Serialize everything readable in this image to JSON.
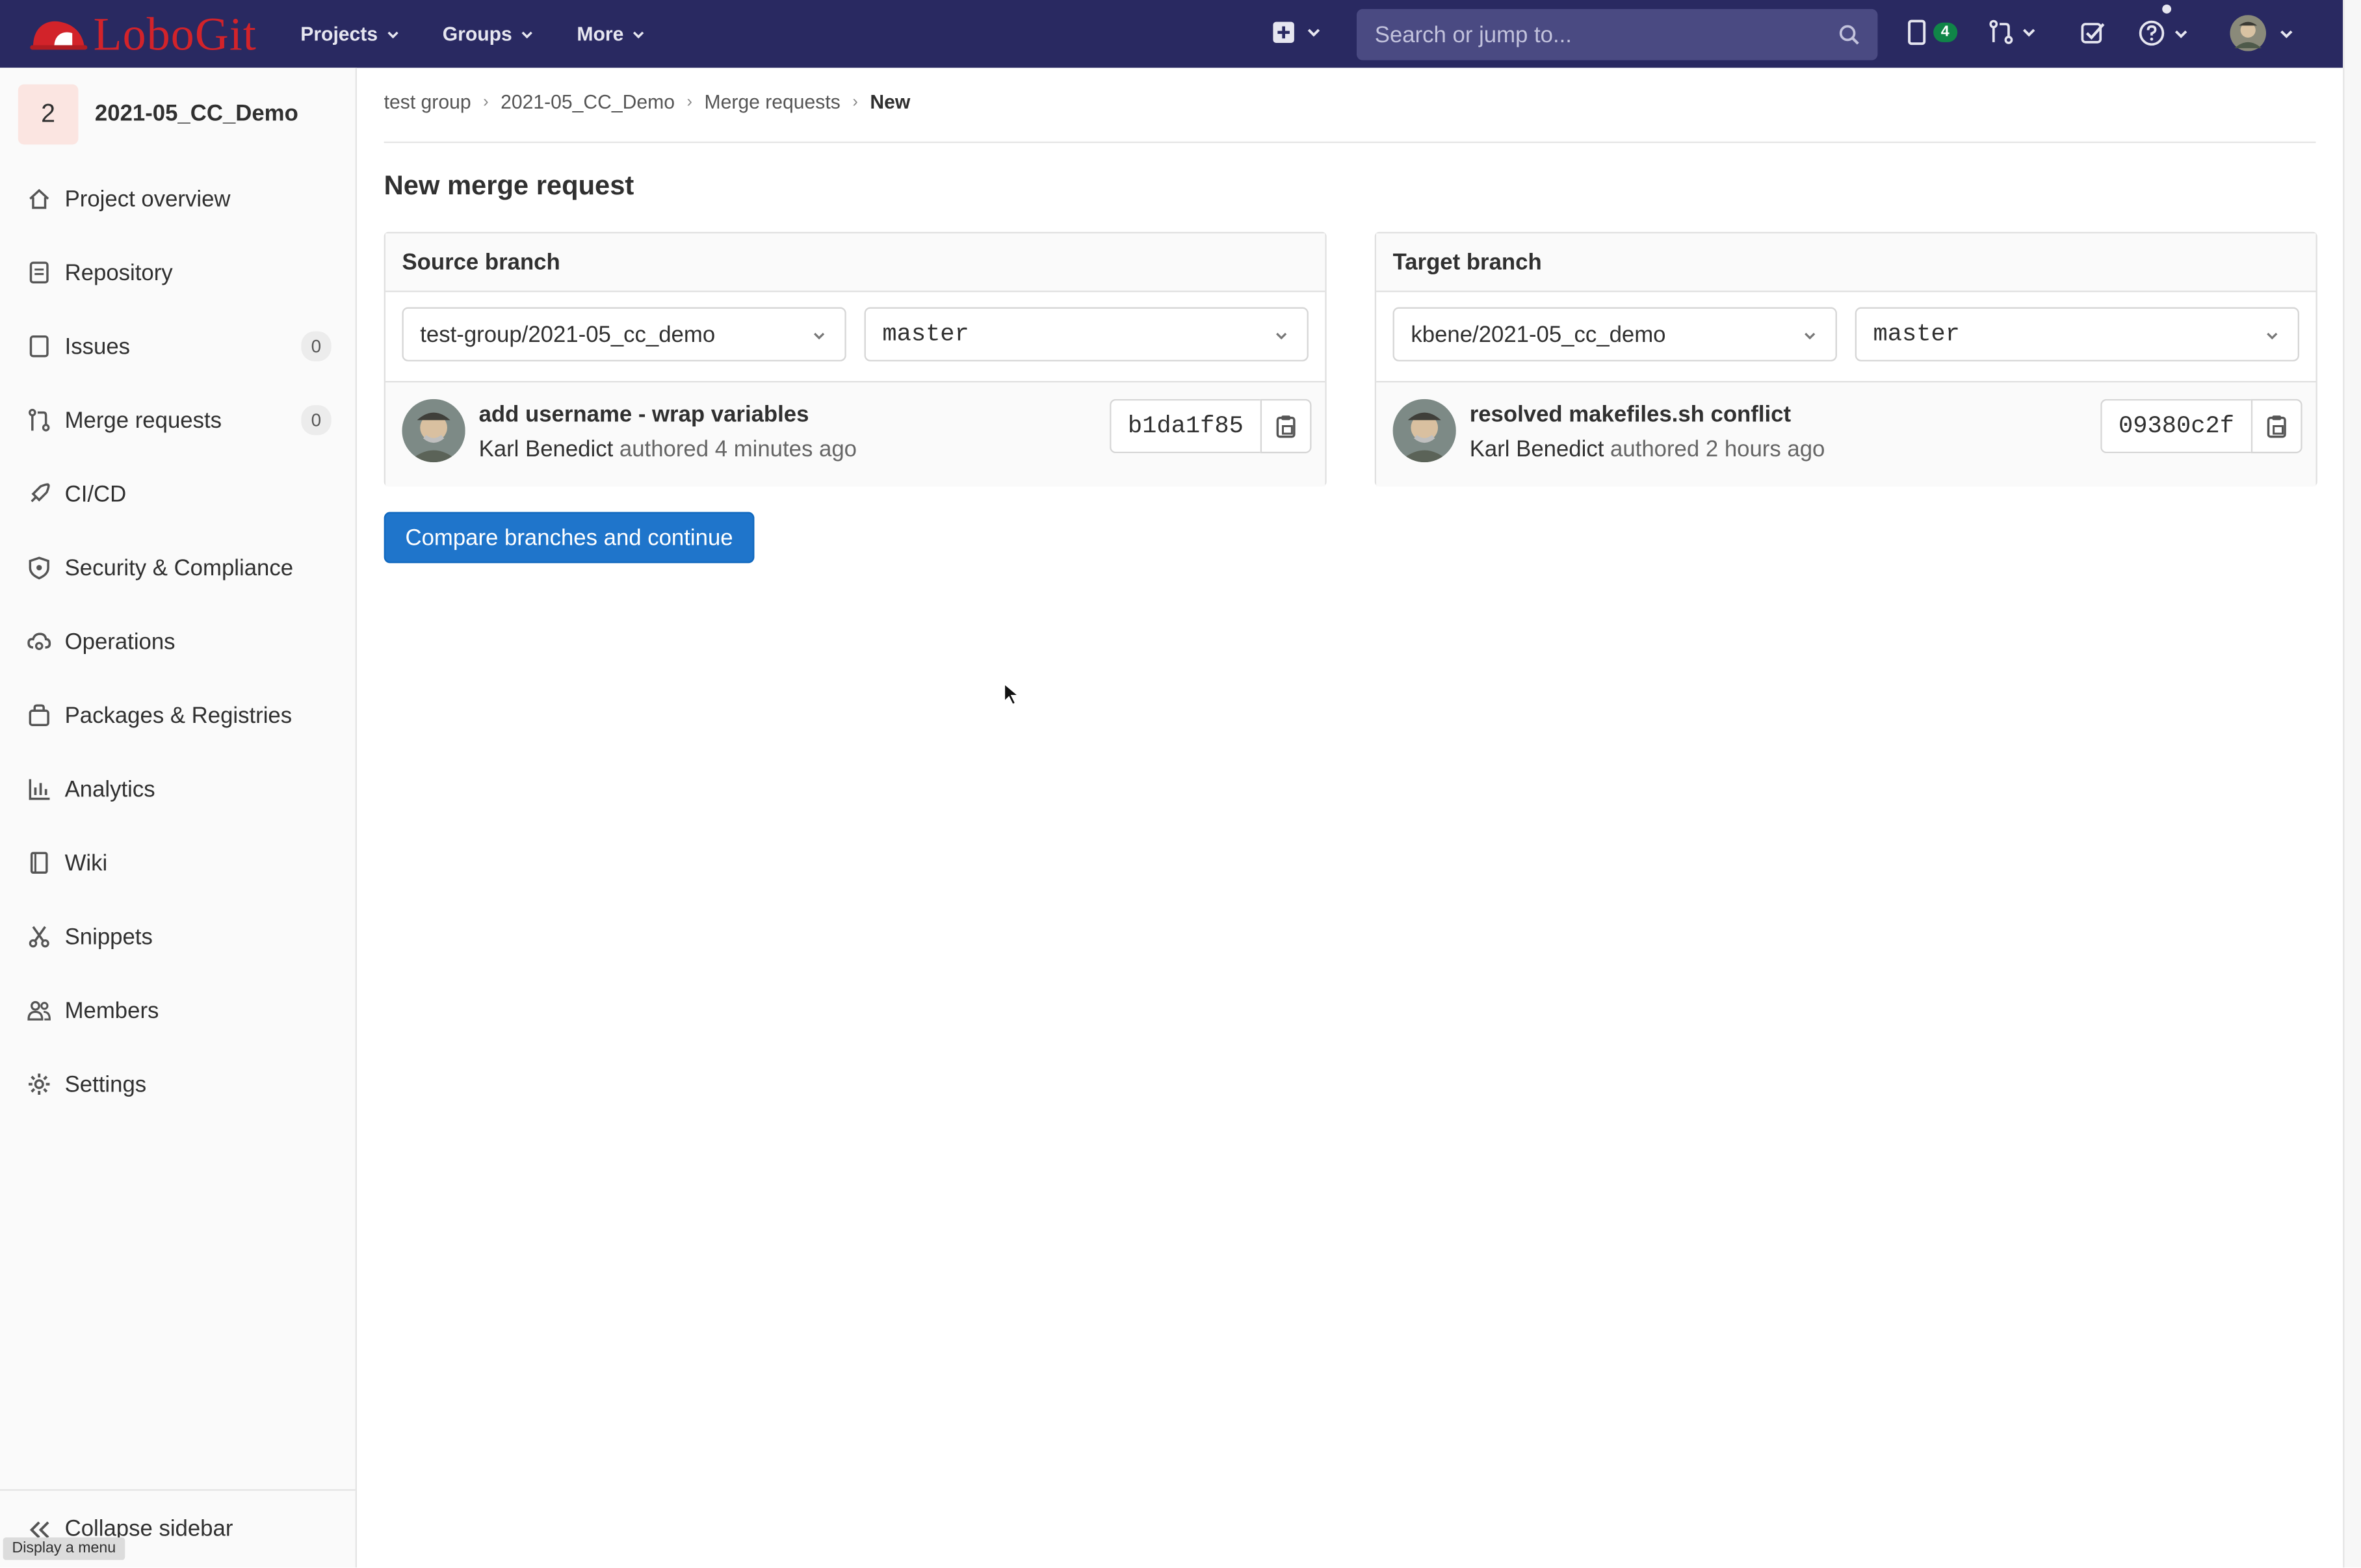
{
  "topbar": {
    "logo_text": "LoboGit",
    "nav": [
      {
        "label": "Projects"
      },
      {
        "label": "Groups"
      },
      {
        "label": "More"
      }
    ],
    "search_placeholder": "Search or jump to...",
    "issues_count": "4",
    "accent": "#292961"
  },
  "sidebar": {
    "project_initial": "2",
    "project_name": "2021-05_CC_Demo",
    "items": [
      {
        "label": "Project overview",
        "icon": "home-icon"
      },
      {
        "label": "Repository",
        "icon": "doc-icon"
      },
      {
        "label": "Issues",
        "icon": "issues-icon",
        "count": "0"
      },
      {
        "label": "Merge requests",
        "icon": "merge-request-icon",
        "count": "0"
      },
      {
        "label": "CI/CD",
        "icon": "rocket-icon"
      },
      {
        "label": "Security & Compliance",
        "icon": "shield-icon"
      },
      {
        "label": "Operations",
        "icon": "cloud-gear-icon"
      },
      {
        "label": "Packages & Registries",
        "icon": "package-icon"
      },
      {
        "label": "Analytics",
        "icon": "chart-icon"
      },
      {
        "label": "Wiki",
        "icon": "book-icon"
      },
      {
        "label": "Snippets",
        "icon": "scissors-icon"
      },
      {
        "label": "Members",
        "icon": "users-icon"
      },
      {
        "label": "Settings",
        "icon": "gear-icon"
      }
    ],
    "collapse_label": "Collapse sidebar",
    "tooltip": "Display a menu"
  },
  "breadcrumb": [
    "test group",
    "2021-05_CC_Demo",
    "Merge requests",
    "New"
  ],
  "page": {
    "title": "New merge request",
    "primary_button": "Compare branches and continue",
    "button_color": "#1f75cb"
  },
  "source": {
    "heading": "Source branch",
    "project": "test-group/2021-05_cc_demo",
    "branch": "master",
    "commit_title": "add username - wrap variables",
    "author": "Karl Benedict",
    "authored": "authored 4 minutes ago",
    "sha": "b1da1f85"
  },
  "target": {
    "heading": "Target branch",
    "project": "kbene/2021-05_cc_demo",
    "branch": "master",
    "commit_title": "resolved makefiles.sh conflict",
    "author": "Karl Benedict",
    "authored": "authored 2 hours ago",
    "sha": "09380c2f"
  }
}
